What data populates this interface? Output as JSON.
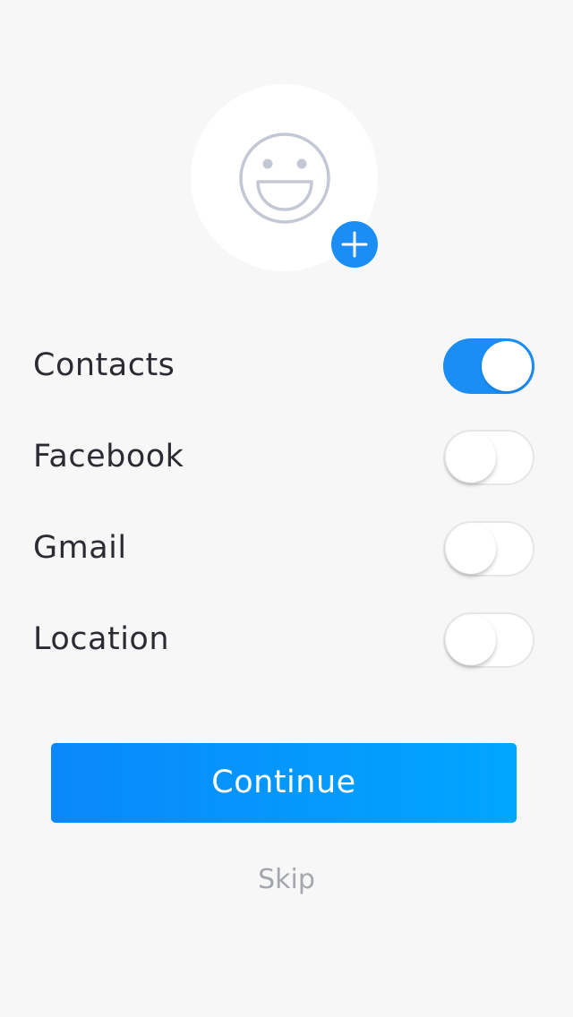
{
  "profile": {
    "avatar_icon": "smiley-face-icon",
    "add_icon": "plus-icon"
  },
  "permissions": [
    {
      "label": "Contacts",
      "enabled": true
    },
    {
      "label": "Facebook",
      "enabled": false
    },
    {
      "label": "Gmail",
      "enabled": false
    },
    {
      "label": "Location",
      "enabled": false
    }
  ],
  "actions": {
    "continue_label": "Continue",
    "skip_label": "Skip"
  },
  "colors": {
    "accent": "#1a8ef5",
    "background": "#f7f7f7",
    "avatar_stroke": "#c3c8d4"
  }
}
